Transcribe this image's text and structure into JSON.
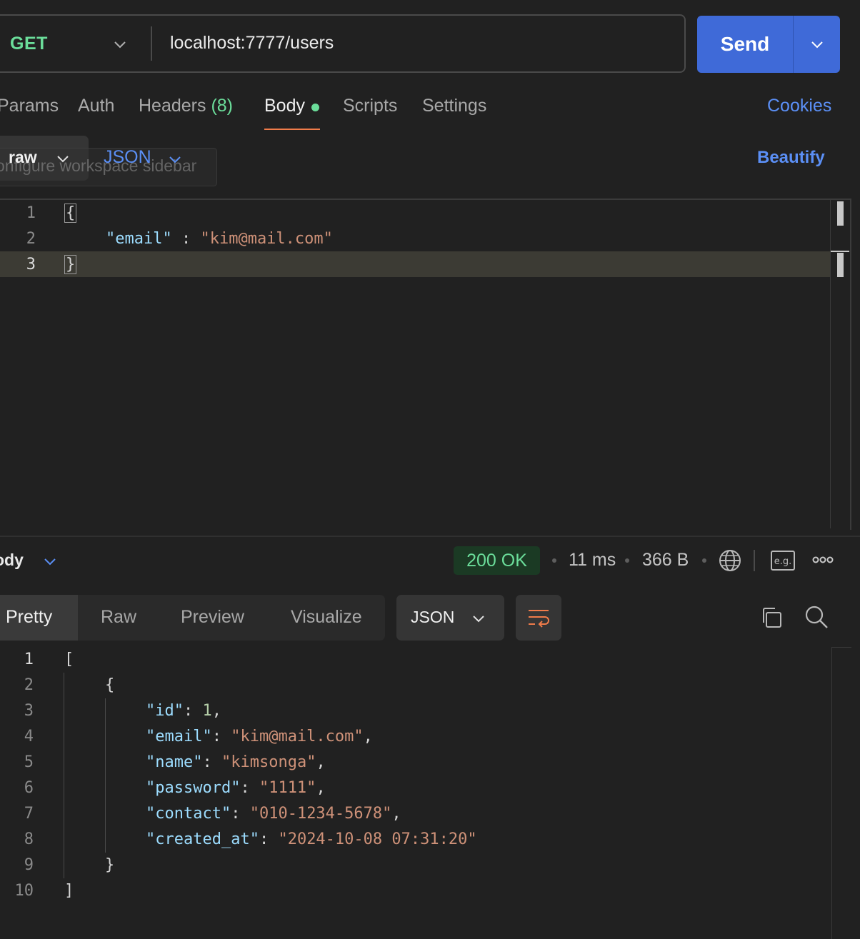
{
  "request": {
    "method": "GET",
    "url": "localhost:7777/users",
    "send_label": "Send"
  },
  "request_tabs": {
    "params": "Params",
    "auth": "Auth",
    "headers": "Headers",
    "headers_count": "(8)",
    "body": "Body",
    "scripts": "Scripts",
    "settings": "Settings",
    "cookies": "Cookies"
  },
  "body_options": {
    "mode": "raw",
    "format": "JSON",
    "beautify": "Beautify",
    "tooltip": "onfigure workspace sidebar"
  },
  "request_editor": {
    "line_numbers": [
      "1",
      "2",
      "3"
    ],
    "line1": "{",
    "line2_key": "\"email\"",
    "line2_sep": " : ",
    "line2_value": "\"kim@mail.com\"",
    "line3": "}"
  },
  "response_header": {
    "label": "ody",
    "status": "200 OK",
    "time": "11 ms",
    "size": "366 B",
    "eg_label": "e.g."
  },
  "response_view": {
    "tabs": [
      "Pretty",
      "Raw",
      "Preview",
      "Visualize"
    ],
    "active_tab": "Pretty",
    "format": "JSON"
  },
  "response_editor": {
    "line_numbers": [
      "1",
      "2",
      "3",
      "4",
      "5",
      "6",
      "7",
      "8",
      "9",
      "10"
    ],
    "open_bracket": "[",
    "open_brace": "{",
    "close_brace": "}",
    "close_bracket": "]",
    "fields": [
      {
        "key": "\"id\"",
        "value": "1",
        "type": "num",
        "trail": ","
      },
      {
        "key": "\"email\"",
        "value": "\"kim@mail.com\"",
        "type": "str",
        "trail": ","
      },
      {
        "key": "\"name\"",
        "value": "\"kimsonga\"",
        "type": "str",
        "trail": ","
      },
      {
        "key": "\"password\"",
        "value": "\"1111\"",
        "type": "str",
        "trail": ","
      },
      {
        "key": "\"contact\"",
        "value": "\"010-1234-5678\"",
        "type": "str",
        "trail": ","
      },
      {
        "key": "\"created_at\"",
        "value": "\"2024-10-08 07:31:20\"",
        "type": "str",
        "trail": ""
      }
    ]
  },
  "colors": {
    "accent_blue": "#3f6ad8",
    "method_green": "#6bdd9a",
    "link_blue": "#5b8ff5",
    "tab_underline": "#f07c4a"
  }
}
